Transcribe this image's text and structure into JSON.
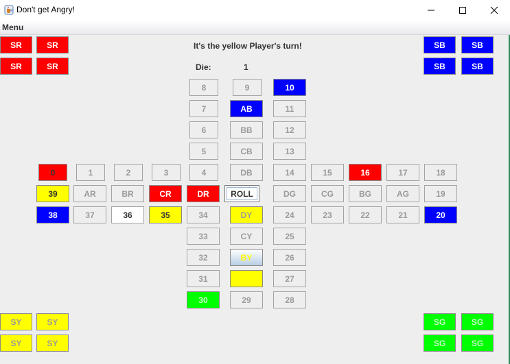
{
  "window": {
    "title": "Don't get Angry!"
  },
  "menu": {
    "items": [
      "Menu"
    ]
  },
  "status": {
    "turn": "It's the yellow Player's turn!",
    "die_label": "Die:",
    "die_value": "1"
  },
  "colors": {
    "red": "#ff0000",
    "blue": "#0000ff",
    "yellow": "#ffff00",
    "green": "#00ff00",
    "white": "#ffffff",
    "default": "#eeeeee",
    "light_blue": "#d6e4f2",
    "text_default": "#9a9a9a",
    "text_dark": "#333333"
  },
  "cells": [
    {
      "name": "home-sr-1",
      "label": "SR",
      "fill": "red",
      "text": "white",
      "i": true
    },
    {
      "name": "home-sr-2",
      "label": "SR",
      "fill": "red",
      "text": "white",
      "i": true
    },
    {
      "name": "home-sr-3",
      "label": "SR",
      "fill": "red",
      "text": "white",
      "i": true
    },
    {
      "name": "home-sr-4",
      "label": "SR",
      "fill": "red",
      "text": "white",
      "i": true
    },
    {
      "name": "home-sb-1",
      "label": "SB",
      "fill": "blue",
      "text": "white",
      "i": true
    },
    {
      "name": "home-sb-2",
      "label": "SB",
      "fill": "blue",
      "text": "white",
      "i": true
    },
    {
      "name": "home-sb-3",
      "label": "SB",
      "fill": "blue",
      "text": "white",
      "i": true
    },
    {
      "name": "home-sb-4",
      "label": "SB",
      "fill": "blue",
      "text": "white",
      "i": true
    },
    {
      "name": "home-sy-1",
      "label": "SY",
      "fill": "yellow",
      "text": "default",
      "i": true
    },
    {
      "name": "home-sy-2",
      "label": "SY",
      "fill": "yellow",
      "text": "default",
      "i": true
    },
    {
      "name": "home-sy-3",
      "label": "SY",
      "fill": "yellow",
      "text": "default",
      "i": true
    },
    {
      "name": "home-sy-4",
      "label": "SY",
      "fill": "yellow",
      "text": "default",
      "i": true
    },
    {
      "name": "home-sg-1",
      "label": "SG",
      "fill": "green",
      "text": "green_text",
      "i": true
    },
    {
      "name": "home-sg-2",
      "label": "SG",
      "fill": "green",
      "text": "green_text",
      "i": true
    },
    {
      "name": "home-sg-3",
      "label": "SG",
      "fill": "green",
      "text": "green_text",
      "i": true
    },
    {
      "name": "home-sg-4",
      "label": "SG",
      "fill": "green",
      "text": "green_text",
      "i": true
    },
    {
      "name": "field-8",
      "label": "8",
      "fill": "default",
      "text": "default",
      "i": true
    },
    {
      "name": "field-9",
      "label": "9",
      "fill": "default",
      "text": "default",
      "i": true
    },
    {
      "name": "field-10",
      "label": "10",
      "fill": "blue",
      "text": "white",
      "i": true
    },
    {
      "name": "field-7",
      "label": "7",
      "fill": "default",
      "text": "default",
      "i": true
    },
    {
      "name": "goal-ab",
      "label": "AB",
      "fill": "blue",
      "text": "white",
      "i": true
    },
    {
      "name": "field-11",
      "label": "11",
      "fill": "default",
      "text": "default",
      "i": true
    },
    {
      "name": "field-6",
      "label": "6",
      "fill": "default",
      "text": "default",
      "i": true
    },
    {
      "name": "goal-bb",
      "label": "BB",
      "fill": "default",
      "text": "default",
      "i": true
    },
    {
      "name": "field-12",
      "label": "12",
      "fill": "default",
      "text": "default",
      "i": true
    },
    {
      "name": "field-5",
      "label": "5",
      "fill": "default",
      "text": "default",
      "i": true
    },
    {
      "name": "goal-cb",
      "label": "CB",
      "fill": "default",
      "text": "default",
      "i": true
    },
    {
      "name": "field-13",
      "label": "13",
      "fill": "default",
      "text": "default",
      "i": true
    },
    {
      "name": "field-0",
      "label": "0",
      "fill": "red",
      "text": "dark",
      "i": true
    },
    {
      "name": "field-1",
      "label": "1",
      "fill": "default",
      "text": "default",
      "i": true
    },
    {
      "name": "field-2",
      "label": "2",
      "fill": "default",
      "text": "default",
      "i": true
    },
    {
      "name": "field-3",
      "label": "3",
      "fill": "default",
      "text": "default",
      "i": true
    },
    {
      "name": "field-4",
      "label": "4",
      "fill": "default",
      "text": "default",
      "i": true
    },
    {
      "name": "goal-db",
      "label": "DB",
      "fill": "default",
      "text": "default",
      "i": true
    },
    {
      "name": "field-14",
      "label": "14",
      "fill": "default",
      "text": "default",
      "i": true
    },
    {
      "name": "field-15",
      "label": "15",
      "fill": "default",
      "text": "default",
      "i": true
    },
    {
      "name": "field-16",
      "label": "16",
      "fill": "red",
      "text": "white",
      "i": true
    },
    {
      "name": "field-17",
      "label": "17",
      "fill": "default",
      "text": "default",
      "i": true
    },
    {
      "name": "field-18",
      "label": "18",
      "fill": "default",
      "text": "default",
      "i": true
    },
    {
      "name": "field-39",
      "label": "39",
      "fill": "yellow",
      "text": "dark",
      "i": true
    },
    {
      "name": "goal-ar",
      "label": "AR",
      "fill": "default",
      "text": "default",
      "i": true
    },
    {
      "name": "goal-br",
      "label": "BR",
      "fill": "default",
      "text": "default",
      "i": true
    },
    {
      "name": "goal-cr",
      "label": "CR",
      "fill": "red",
      "text": "white",
      "i": true
    },
    {
      "name": "goal-dr",
      "label": "DR",
      "fill": "red",
      "text": "white",
      "i": true
    },
    {
      "name": "roll-button",
      "label": "ROLL",
      "fill": "white",
      "text": "dark",
      "i": true
    },
    {
      "name": "goal-dg",
      "label": "DG",
      "fill": "default",
      "text": "default",
      "i": true
    },
    {
      "name": "goal-cg",
      "label": "CG",
      "fill": "default",
      "text": "default",
      "i": true
    },
    {
      "name": "goal-bg",
      "label": "BG",
      "fill": "default",
      "text": "default",
      "i": true
    },
    {
      "name": "goal-ag",
      "label": "AG",
      "fill": "default",
      "text": "default",
      "i": true
    },
    {
      "name": "field-19",
      "label": "19",
      "fill": "default",
      "text": "default",
      "i": true
    },
    {
      "name": "field-38",
      "label": "38",
      "fill": "blue",
      "text": "white",
      "i": true
    },
    {
      "name": "field-37",
      "label": "37",
      "fill": "default",
      "text": "default",
      "i": true
    },
    {
      "name": "field-36",
      "label": "36",
      "fill": "white",
      "text": "dark",
      "i": true
    },
    {
      "name": "field-35",
      "label": "35",
      "fill": "yellow",
      "text": "dark",
      "i": true
    },
    {
      "name": "field-34",
      "label": "34",
      "fill": "default",
      "text": "default",
      "i": true
    },
    {
      "name": "goal-dy",
      "label": "DY",
      "fill": "yellow",
      "text": "default",
      "i": true
    },
    {
      "name": "field-24",
      "label": "24",
      "fill": "default",
      "text": "default",
      "i": true
    },
    {
      "name": "field-23",
      "label": "23",
      "fill": "default",
      "text": "default",
      "i": true
    },
    {
      "name": "field-22",
      "label": "22",
      "fill": "default",
      "text": "default",
      "i": true
    },
    {
      "name": "field-21",
      "label": "21",
      "fill": "default",
      "text": "default",
      "i": true
    },
    {
      "name": "field-20",
      "label": "20",
      "fill": "blue",
      "text": "white",
      "i": true
    },
    {
      "name": "field-33",
      "label": "33",
      "fill": "default",
      "text": "default",
      "i": true
    },
    {
      "name": "goal-cy",
      "label": "CY",
      "fill": "default",
      "text": "default",
      "i": true
    },
    {
      "name": "field-25",
      "label": "25",
      "fill": "default",
      "text": "default",
      "i": true
    },
    {
      "name": "field-32",
      "label": "32",
      "fill": "default",
      "text": "default",
      "i": true
    },
    {
      "name": "goal-by",
      "label": "BY",
      "fill": "light_blue",
      "text": "yellow_text",
      "i": true
    },
    {
      "name": "field-26",
      "label": "26",
      "fill": "default",
      "text": "default",
      "i": true
    },
    {
      "name": "field-31",
      "label": "31",
      "fill": "default",
      "text": "default",
      "i": true
    },
    {
      "name": "goal-ay",
      "label": "",
      "fill": "yellow",
      "text": "dark",
      "i": true
    },
    {
      "name": "field-27",
      "label": "27",
      "fill": "default",
      "text": "default",
      "i": true
    },
    {
      "name": "field-30",
      "label": "30",
      "fill": "green",
      "text": "green_text",
      "i": true
    },
    {
      "name": "field-29",
      "label": "29",
      "fill": "default",
      "text": "default",
      "i": true
    },
    {
      "name": "field-28",
      "label": "28",
      "fill": "default",
      "text": "default",
      "i": true
    }
  ]
}
